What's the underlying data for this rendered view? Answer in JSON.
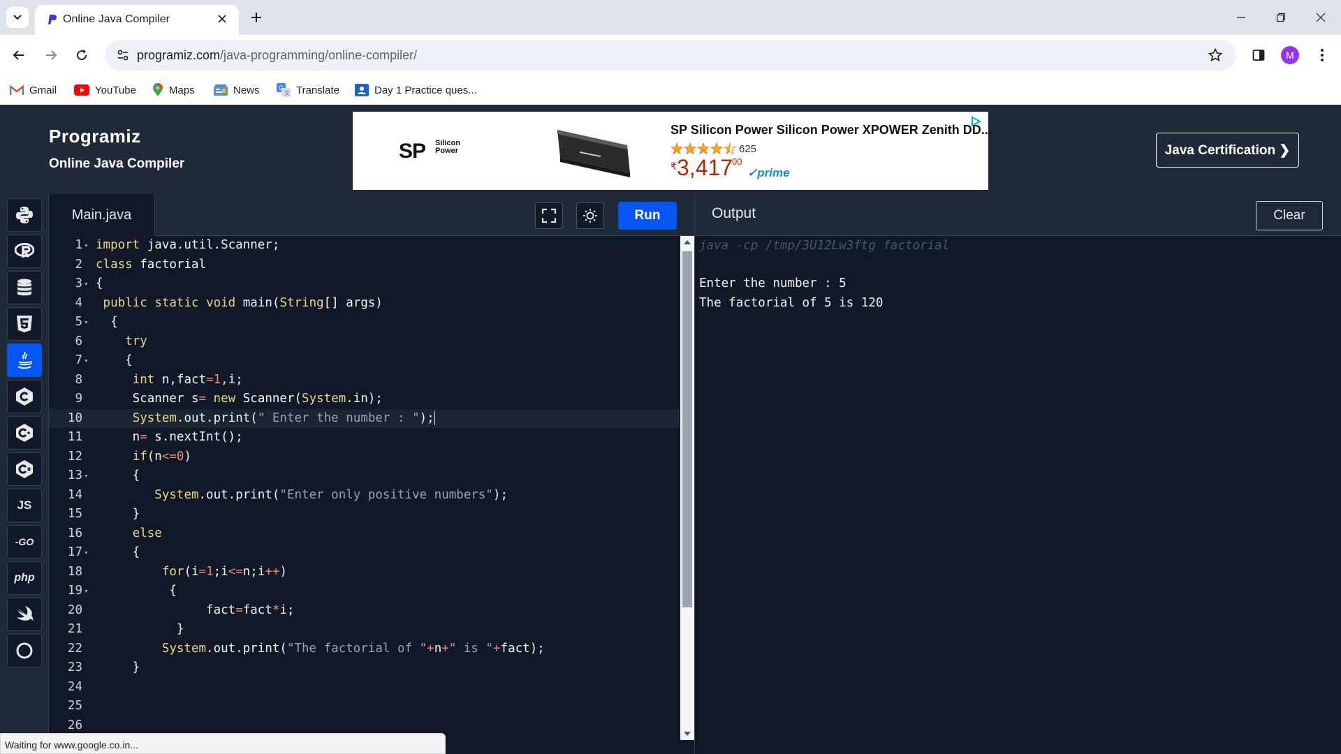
{
  "browser": {
    "tab": {
      "title": "Online Java Compiler"
    },
    "url": {
      "host": "programiz.com",
      "path": "/java-programming/online-compiler/"
    },
    "profile_initial": "M",
    "bookmarks": [
      {
        "label": "Gmail",
        "icon": "gmail-icon"
      },
      {
        "label": "YouTube",
        "icon": "youtube-icon"
      },
      {
        "label": "Maps",
        "icon": "maps-icon"
      },
      {
        "label": "News",
        "icon": "news-icon"
      },
      {
        "label": "Translate",
        "icon": "translate-icon"
      },
      {
        "label": "Day 1 Practice ques...",
        "icon": "classroom-icon"
      }
    ],
    "status": "Waiting for www.google.co.in..."
  },
  "header": {
    "logo": "Programiz",
    "subtitle": "Online Java Compiler",
    "cert_button": "Java Certification ❯",
    "ad": {
      "brand": "SP",
      "brand_small_1": "Silicon",
      "brand_small_2": "Power",
      "title": "SP Silicon Power Silicon Power XPOWER Zenith DD...",
      "rating_count": "625",
      "price_symbol": "₹",
      "price": "3,417",
      "price_cents": "00",
      "prime": "✓prime"
    }
  },
  "rail": {
    "languages": [
      {
        "name": "python",
        "glyph": ""
      },
      {
        "name": "r",
        "glyph": ""
      },
      {
        "name": "sql",
        "glyph": ""
      },
      {
        "name": "html",
        "glyph": ""
      },
      {
        "name": "java",
        "glyph": "",
        "active": true
      },
      {
        "name": "c",
        "glyph": ""
      },
      {
        "name": "cpp",
        "glyph": ""
      },
      {
        "name": "csharp",
        "glyph": ""
      },
      {
        "name": "javascript",
        "glyph": "JS"
      },
      {
        "name": "go",
        "glyph": "-GO"
      },
      {
        "name": "php",
        "glyph": "php"
      },
      {
        "name": "swift",
        "glyph": ""
      }
    ]
  },
  "editor": {
    "file_tab": "Main.java",
    "run_label": "Run",
    "active_line": 10,
    "lines": [
      "import java.util.Scanner;",
      "class factorial",
      "{",
      " public static void main(String[] args)",
      "  {",
      "    try",
      "    {",
      "     int n,fact=1,i;",
      "     Scanner s= new Scanner(System.in);",
      "     System.out.print(\" Enter the number : \");",
      "     n= s.nextInt();",
      "     if(n<=0)",
      "     {",
      "        System.out.print(\"Enter only positive numbers\");",
      "     }",
      "     else",
      "     {",
      "         for(i=1;i<=n;i++)",
      "          {",
      "               fact=fact*i;",
      "           }",
      "         System.out.print(\"The factorial of \"+n+\" is \"+fact);",
      "     }",
      "",
      "",
      ""
    ],
    "folds": [
      1,
      3,
      5,
      7,
      13,
      17,
      19
    ]
  },
  "output": {
    "title": "Output",
    "clear_label": "Clear",
    "command": "java -cp /tmp/3U12Lw3ftg factorial",
    "lines": [
      "Enter the number : 5",
      "The factorial of 5 is 120"
    ]
  }
}
